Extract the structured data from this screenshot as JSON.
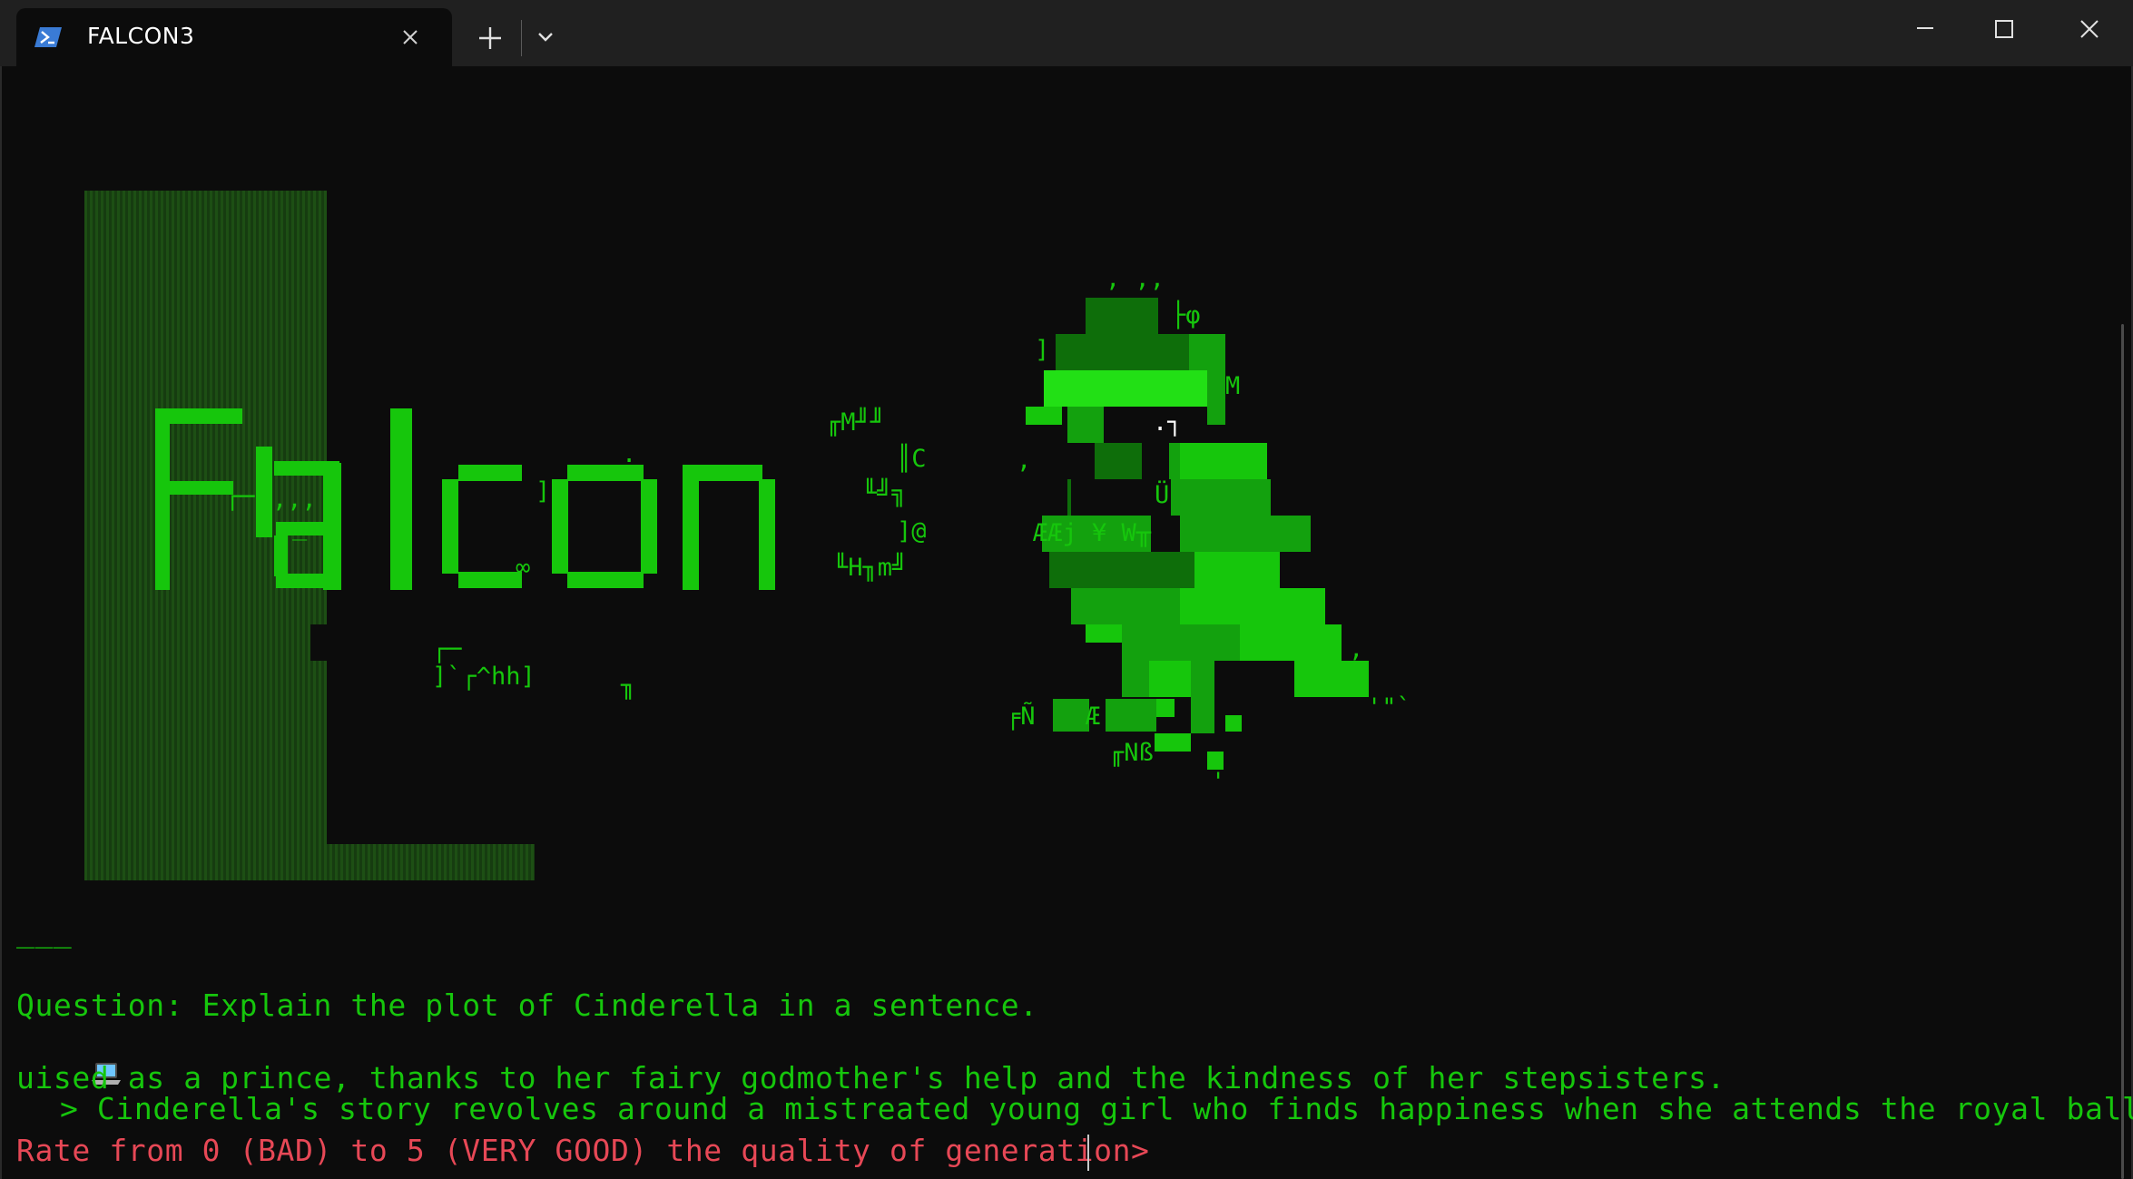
{
  "window": {
    "tab_title": "FALCON3",
    "tab_icon": "powershell-icon"
  },
  "art": {
    "word": "Falcon 3",
    "fragments": {
      "top_glyphs": ", ,,",
      "phi": "├φ",
      "m_right": "M",
      "box_m": "╓M╜╜",
      "c_side": "║C",
      "box_2": "╙╝╗",
      "at_side": "]@",
      "hm": "╙H╖m╝",
      "u_mark": "Ü",
      "ae_row": "ÆÆj ¥ W╥",
      "bracket_l": "]",
      "comma_right": ",",
      "quote_right": "'\"`",
      "nt": "╒Ñ",
      "ae_low": "Æ",
      "nss": "╓Nß",
      "tick": "'",
      "hh": "]`┌^hh]",
      "corner_small": "┌─",
      "corner_r": "╖",
      "infinity": "∞",
      "semi": ";",
      "commas": ",,,",
      "dot_j": ".┐",
      "dots_mid": "_.",
      "comma_l": ","
    }
  },
  "terminal": {
    "separator": "___",
    "question": "Question: Explain the plot of Cinderella in a sentence.",
    "answer_line1": "> Cinderella's story revolves around a mistreated young girl who finds happiness when she attends the royal ball disg",
    "answer_line2": "uised as a prince, thanks to her fairy godmother's help and the kindness of her stepsisters.",
    "answer_icon": "laptop-icon",
    "prompt": "Rate from 0 (BAD) to 5 (VERY GOOD) the quality of generation> ",
    "input_value": ""
  },
  "colors": {
    "terminal_bg": "#0c0c0c",
    "titlebar_bg": "#202020",
    "green": "#16c60c",
    "red": "#e74856"
  }
}
